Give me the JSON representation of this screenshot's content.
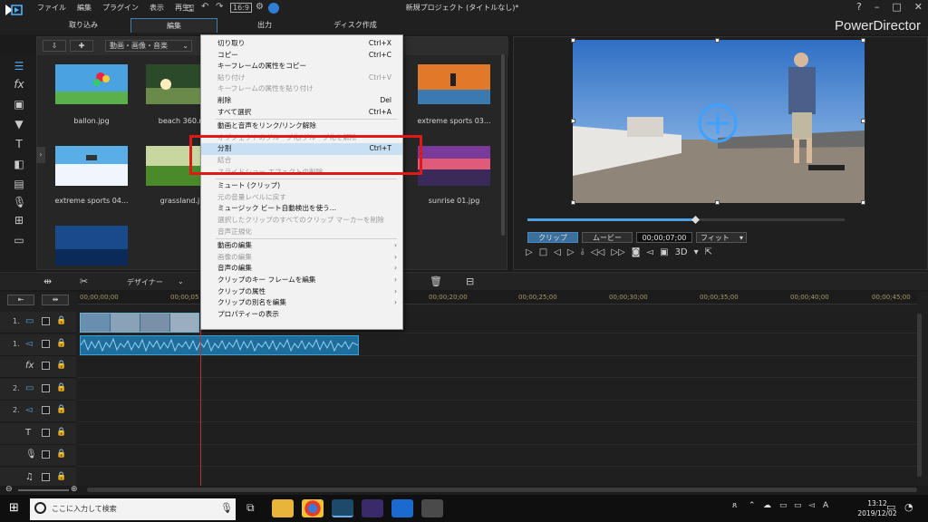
{
  "menu": [
    "ファイル",
    "編集",
    "プラグイン",
    "表示",
    "再生"
  ],
  "window_title": "新規プロジェクト (タイトルなし)*",
  "window_buttons": [
    "?",
    "–",
    "□",
    "✕"
  ],
  "tabs": [
    "取り込み",
    "編集",
    "出力",
    "ディスク作成"
  ],
  "brand": "PowerDirector",
  "library": {
    "filter": "動画・画像・音楽",
    "items": [
      {
        "label": "ballon.jpg"
      },
      {
        "label": "beach 360.m"
      },
      {
        "label": "extreme sports 03..."
      },
      {
        "label": "extreme sports 04..."
      },
      {
        "label": "grassland.jp"
      },
      {
        "label": "sunrise 01.jpg"
      }
    ]
  },
  "context_menu": [
    {
      "label": "切り取り",
      "shortcut": "Ctrl+X",
      "disabled": false
    },
    {
      "label": "コピー",
      "shortcut": "Ctrl+C",
      "disabled": false
    },
    {
      "label": "キーフレームの属性をコピー",
      "shortcut": "",
      "disabled": false
    },
    {
      "label": "貼り付け",
      "shortcut": "Ctrl+V",
      "disabled": true
    },
    {
      "label": "キーフレームの属性を貼り付け",
      "shortcut": "",
      "disabled": true
    },
    {
      "label": "削除",
      "shortcut": "Del",
      "disabled": false
    },
    {
      "label": "すべて選択",
      "shortcut": "Ctrl+A",
      "disabled": false
    },
    {
      "label": "動画と音声をリンク/リンク解除",
      "shortcut": "",
      "disabled": false
    },
    {
      "label": "オブジェクトのグループ化/グループ化を解除",
      "shortcut": "",
      "disabled": true
    },
    {
      "label": "分割",
      "shortcut": "Ctrl+T",
      "disabled": false,
      "highlighted": true
    },
    {
      "label": "結合",
      "shortcut": "",
      "disabled": true
    },
    {
      "label": "スライドショー エフェクトの削除",
      "shortcut": "",
      "disabled": true
    },
    {
      "label": "ミュート (クリップ)",
      "shortcut": "",
      "disabled": false
    },
    {
      "label": "元の音量レベルに戻す",
      "shortcut": "",
      "disabled": true
    },
    {
      "label": "ミュージック ビート自動検出を使う...",
      "shortcut": "",
      "disabled": false
    },
    {
      "label": "選択したクリップのすべてのクリップ マーカーを削除",
      "shortcut": "",
      "disabled": true
    },
    {
      "label": "音声正規化",
      "shortcut": "",
      "disabled": true
    },
    {
      "label": "動画の編集",
      "shortcut": "",
      "disabled": false,
      "submenu": true
    },
    {
      "label": "画像の編集",
      "shortcut": "",
      "disabled": true,
      "submenu": true
    },
    {
      "label": "音声の編集",
      "shortcut": "",
      "disabled": false,
      "submenu": true
    },
    {
      "label": "クリップのキー フレームを編集",
      "shortcut": "",
      "disabled": false,
      "submenu": true
    },
    {
      "label": "クリップの属性",
      "shortcut": "",
      "disabled": false,
      "submenu": true
    },
    {
      "label": "クリップの別名を編集",
      "shortcut": "",
      "disabled": false,
      "submenu": true
    },
    {
      "label": "プロパティーの表示",
      "shortcut": "",
      "disabled": false
    }
  ],
  "preview": {
    "mode_clip": "クリップ",
    "mode_movie": "ムービー",
    "timecode": "00;00;07;00",
    "fit": "フィット",
    "three_d": "3D"
  },
  "toolbar": {
    "designer": "デザイナー"
  },
  "ruler": [
    "00;00;00;00",
    "00;00;05",
    "00;00;20;00",
    "00;00;25;00",
    "00;00;30;00",
    "00;00;35;00",
    "00;00;40;00",
    "00;00;45;00"
  ],
  "tracks": [
    {
      "num": "1.",
      "icon": "video"
    },
    {
      "num": "1.",
      "icon": "audio"
    },
    {
      "num": "",
      "icon": "fx"
    },
    {
      "num": "2.",
      "icon": "video"
    },
    {
      "num": "2.",
      "icon": "audio"
    },
    {
      "num": "",
      "icon": "title"
    },
    {
      "num": "",
      "icon": "voice"
    },
    {
      "num": "",
      "icon": "music"
    }
  ],
  "taskbar": {
    "search_placeholder": "ここに入力して検索",
    "time": "13:12",
    "date": "2019/12/02",
    "ime": "A"
  }
}
